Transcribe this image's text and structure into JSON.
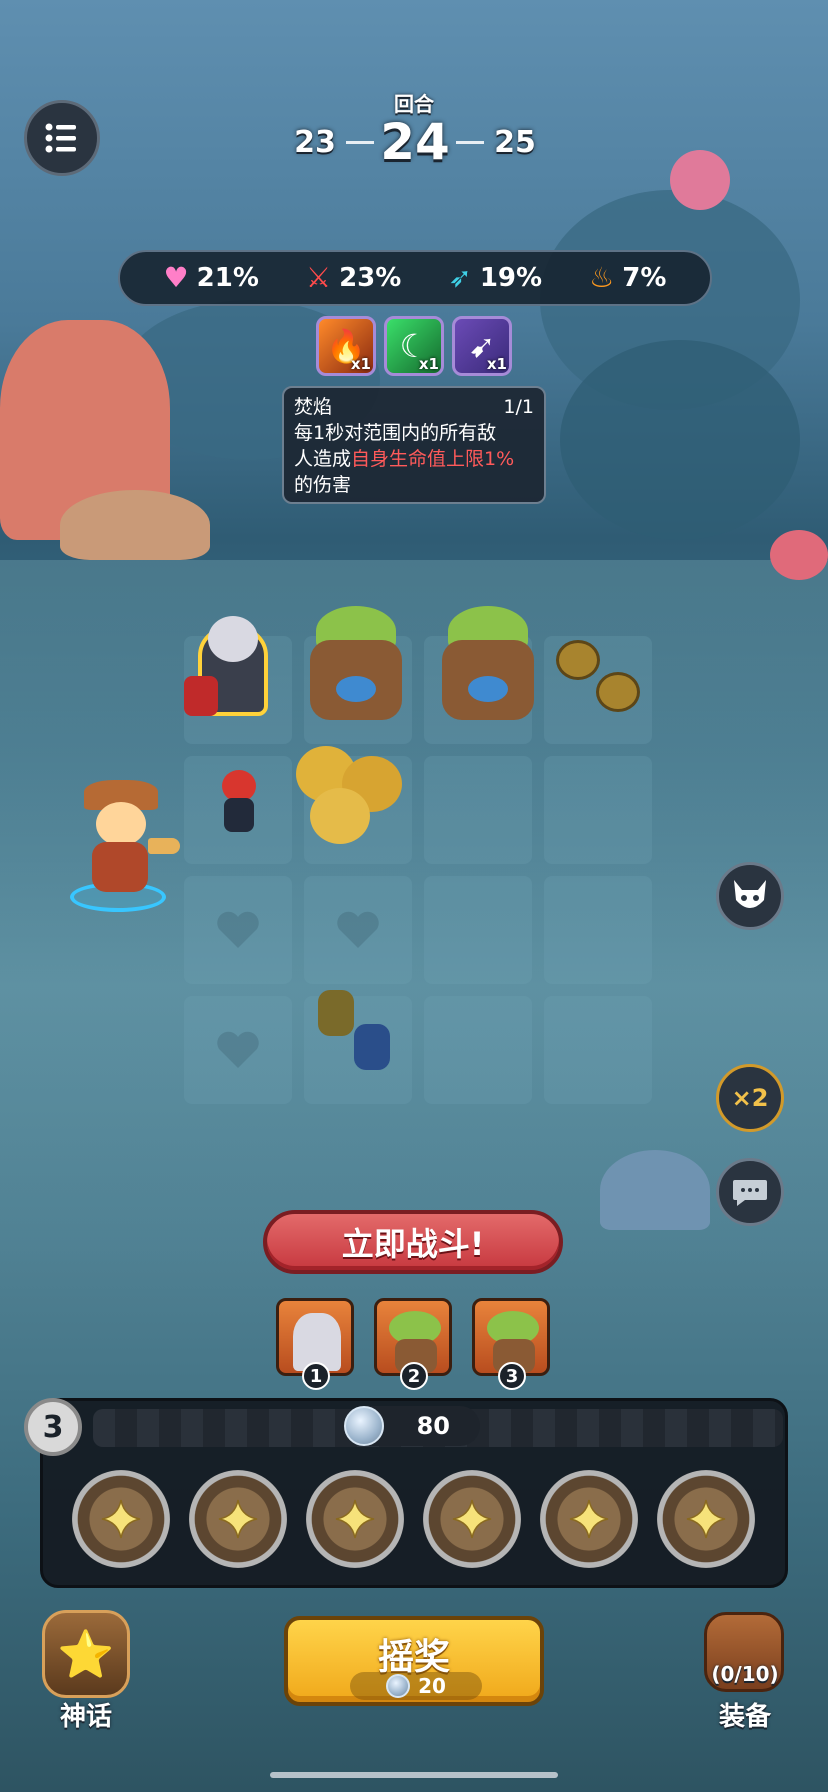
{
  "round": {
    "label": "回合",
    "previous": "23",
    "current": "24",
    "next": "25"
  },
  "stats": [
    {
      "icon": "heart-icon",
      "value": "21%",
      "color": "#ff7fc8"
    },
    {
      "icon": "sword-icon",
      "value": "23%",
      "color": "#ff4b4b"
    },
    {
      "icon": "wing-icon",
      "value": "19%",
      "color": "#3fd0e6"
    },
    {
      "icon": "fire-icon",
      "value": "7%",
      "color": "#ff9a1f"
    }
  ],
  "buffs": [
    {
      "icon": "flame-icon",
      "count": "x1"
    },
    {
      "icon": "moon-heal-icon",
      "count": "x1"
    },
    {
      "icon": "spear-icon",
      "count": "x1"
    }
  ],
  "tooltip": {
    "title": "焚焰",
    "progress": "1/1",
    "line1": "每1秒对范围内的所有敌",
    "line2_prefix": "人造成",
    "line2_highlight": "自身生命值上限1%",
    "line3": "的伤害",
    "highlight_color": "#ff5a5a"
  },
  "fight_button": "立即战斗!",
  "team": [
    {
      "slot": "1",
      "name": "wolf-knight"
    },
    {
      "slot": "2",
      "name": "treant"
    },
    {
      "slot": "3",
      "name": "treant"
    }
  ],
  "shop": {
    "level": "3",
    "coins": "80",
    "slots": [
      "empty",
      "empty",
      "empty",
      "empty",
      "empty",
      "empty"
    ]
  },
  "roll_button": {
    "label": "摇奖",
    "cost": "20"
  },
  "myth_button": {
    "label": "神话"
  },
  "equip_button": {
    "label": "装备",
    "count": "(0/10)"
  }
}
